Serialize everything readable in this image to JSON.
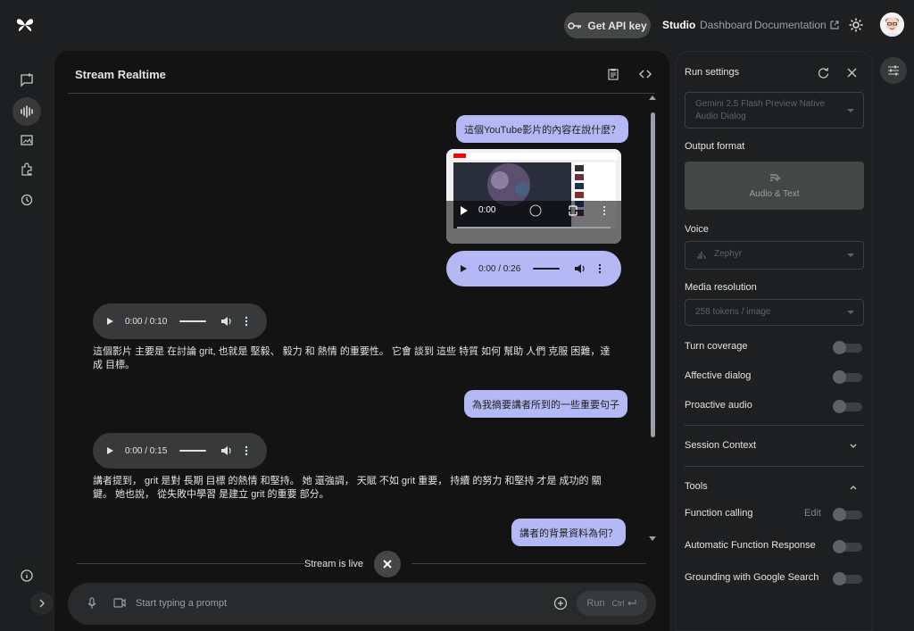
{
  "header": {
    "api_key_label": "Get API key",
    "nav_studio": "Studio",
    "nav_dashboard": "Dashboard",
    "nav_documentation": "Documentation"
  },
  "main": {
    "title": "Stream Realtime",
    "messages": {
      "user_1": "這個YouTube影片的內容在說什麼？",
      "user_audio_time": "0:00 / 0:26",
      "video_time": "0:00",
      "model_audio_1_time": "0:00 / 0:10",
      "model_text_1": "這個影片 主要是 在討論 grit, 也就是 堅毅、 毅力 和 熱情 的重要性。 它會 談到 這些 特質 如何 幫助 人們 克服 困難，達成 目標。",
      "user_2": "為我摘要講者所到的一些重要句子",
      "model_audio_2_time": "0:00 / 0:15",
      "model_text_2": "講者提到， grit 是對 長期 目標 的熱情 和堅持。 她 還強調， 天賦 不如 grit 重要， 持續 的努力 和堅持 才是 成功的 關鍵。 她也說， 從失敗中學習 是建立 grit 的重要 部分。",
      "user_3": "講者的背景資料為何？"
    },
    "stream_status": "Stream is live",
    "input_placeholder": "Start typing a prompt",
    "run_label": "Run",
    "run_shortcut": "Ctrl"
  },
  "settings": {
    "title": "Run settings",
    "model": "Gemini 2.5 Flash Preview Native Audio Dialog",
    "output_format_label": "Output format",
    "output_format_value": "Audio & Text",
    "voice_label": "Voice",
    "voice_value": "Zephyr",
    "media_resolution_label": "Media resolution",
    "media_resolution_value": "258 tokens / image",
    "turn_coverage": "Turn coverage",
    "affective_dialog": "Affective dialog",
    "proactive_audio": "Proactive audio",
    "session_context": "Session Context",
    "tools": "Tools",
    "function_calling": "Function calling",
    "edit": "Edit",
    "automatic_function_response": "Automatic Function Response",
    "grounding": "Grounding with Google Search"
  },
  "colors": {
    "user_bubble": "#b4b8f5",
    "background": "#1e1f20",
    "panel": "#131314"
  }
}
